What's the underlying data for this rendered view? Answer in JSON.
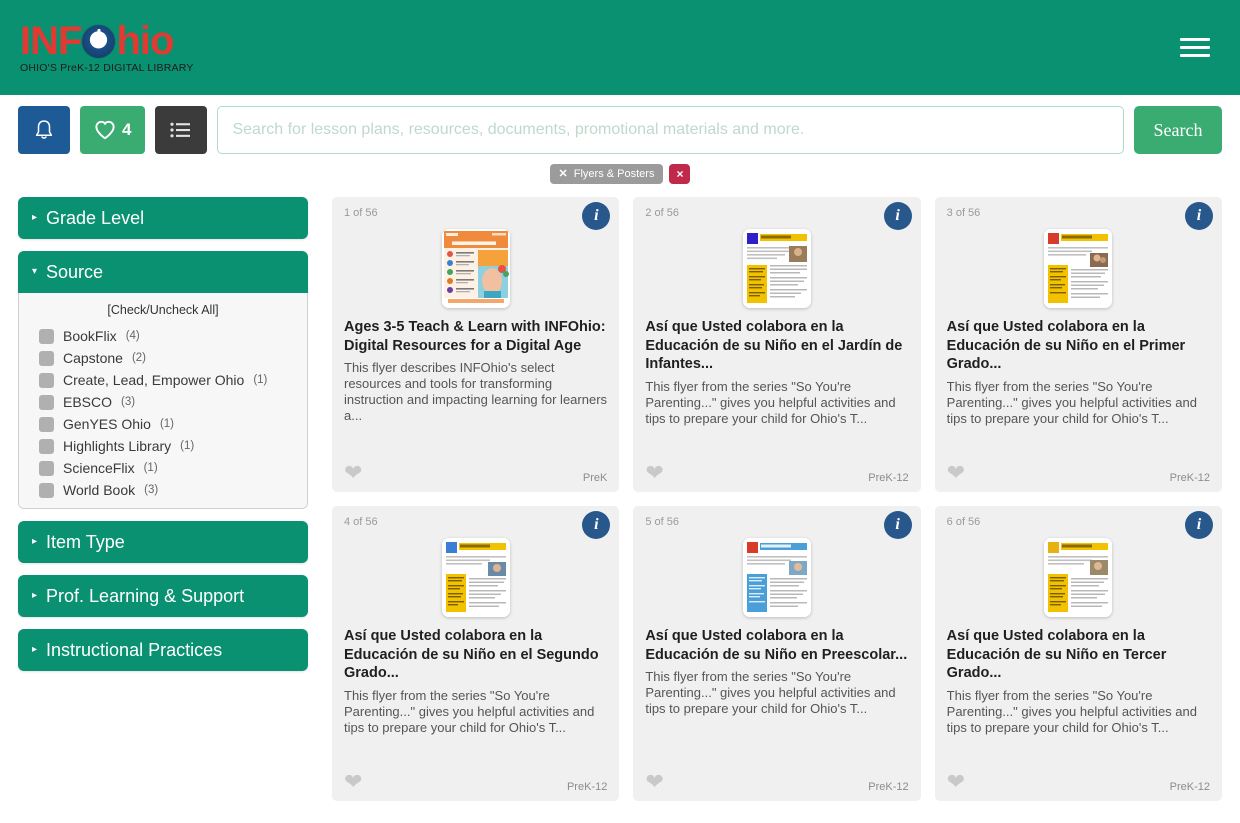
{
  "header": {
    "logo_text_1": "INF",
    "logo_icon": "power-button-icon",
    "logo_text_2": "hio",
    "tagline": "OHIO'S PreK-12 DIGITAL LIBRARY",
    "menu_icon": "hamburger-menu-icon",
    "brand_green": "#0a9171",
    "logo_red": "#e03a32",
    "logo_blue": "#1b4f86"
  },
  "search": {
    "placeholder": "Search for lesson plans, resources, documents, promotional materials and more.",
    "value": "",
    "submit_label": "Search",
    "notifications_icon": "bell-icon",
    "favorites_icon": "heart-icon",
    "favorites_count": "4",
    "list_view_icon": "list-icon"
  },
  "active_filters": {
    "chips": [
      {
        "label": "Flyers & Posters",
        "remove_icon": "close-icon"
      }
    ],
    "clear_all_label": "×",
    "clear_all_icon": "clear-all-icon"
  },
  "sidebar": {
    "facets": [
      {
        "label": "Grade Level",
        "expanded": false,
        "caret": "▸"
      },
      {
        "label": "Source",
        "expanded": true,
        "caret": "▾",
        "check_all_label": "[Check/Uncheck All]",
        "items": [
          {
            "label": "BookFlix",
            "count": "(4)",
            "checked": false
          },
          {
            "label": "Capstone",
            "count": "(2)",
            "checked": false
          },
          {
            "label": "Create, Lead, Empower Ohio",
            "count": "(1)",
            "checked": false
          },
          {
            "label": "EBSCO",
            "count": "(3)",
            "checked": false
          },
          {
            "label": "GenYES Ohio",
            "count": "(1)",
            "checked": false
          },
          {
            "label": "Highlights Library",
            "count": "(1)",
            "checked": false
          },
          {
            "label": "ScienceFlix",
            "count": "(1)",
            "checked": false
          },
          {
            "label": "World Book",
            "count": "(3)",
            "checked": false
          }
        ]
      },
      {
        "label": "Item Type",
        "expanded": false,
        "caret": "▸"
      },
      {
        "label": "Prof. Learning & Support",
        "expanded": false,
        "caret": "▸"
      },
      {
        "label": "Instructional Practices",
        "expanded": false,
        "caret": "▸"
      }
    ]
  },
  "results": {
    "total": "56",
    "cards": [
      {
        "counter": "1 of 56",
        "title": "Ages 3-5 Teach & Learn with INFOhio: Digital Resources for a Digital Age",
        "description": "This flyer describes INFOhio's select resources and tools for transforming instruction and impacting learning for learners a...",
        "grade": "PreK",
        "info_icon": "info-icon",
        "favorite_icon": "heart-icon",
        "thumb_style": "orange-flyer",
        "thumb_accent": "#f08a3c"
      },
      {
        "counter": "2 of 56",
        "title": "Así que Usted colabora en la Educación de su Niño en el Jardín de Infantes...",
        "description": "This flyer from the series \"So You're Parenting...\" gives you helpful activities and tips to prepare your child for Ohio's T...",
        "grade": "PreK-12",
        "info_icon": "info-icon",
        "favorite_icon": "heart-icon",
        "thumb_style": "text-flyer",
        "thumb_accent": "#2f20c7"
      },
      {
        "counter": "3 of 56",
        "title": "Así que Usted colabora en la Educación de su Niño en el Primer Grado...",
        "description": "This flyer from the series \"So You're Parenting...\" gives you helpful activities and tips to prepare your child for Ohio's T...",
        "grade": "PreK-12",
        "info_icon": "info-icon",
        "favorite_icon": "heart-icon",
        "thumb_style": "text-flyer",
        "thumb_accent": "#d93b2b"
      },
      {
        "counter": "4 of 56",
        "title": "Así que Usted colabora en la Educación de su Niño en el Segundo Grado...",
        "description": "This flyer from the series \"So You're Parenting...\" gives you helpful activities and tips to prepare your child for Ohio's T...",
        "grade": "PreK-12",
        "info_icon": "info-icon",
        "favorite_icon": "heart-icon",
        "thumb_style": "text-flyer",
        "thumb_accent": "#3a7fd5"
      },
      {
        "counter": "5 of 56",
        "title": "Así que Usted colabora en la Educación de su Niño en Preescolar...",
        "description": "This flyer from the series \"So You're Parenting...\" gives you helpful activities and tips to prepare your child for Ohio's T...",
        "grade": "PreK-12",
        "info_icon": "info-icon",
        "favorite_icon": "heart-icon",
        "thumb_style": "text-flyer",
        "thumb_accent": "#d93b2b"
      },
      {
        "counter": "6 of 56",
        "title": "Así que Usted colabora en la Educación de su Niño en Tercer Grado...",
        "description": "This flyer from the series \"So You're Parenting...\" gives you helpful activities and tips to prepare your child for Ohio's T...",
        "grade": "PreK-12",
        "info_icon": "info-icon",
        "favorite_icon": "heart-icon",
        "thumb_style": "text-flyer",
        "thumb_accent": "#e8b010"
      }
    ]
  }
}
